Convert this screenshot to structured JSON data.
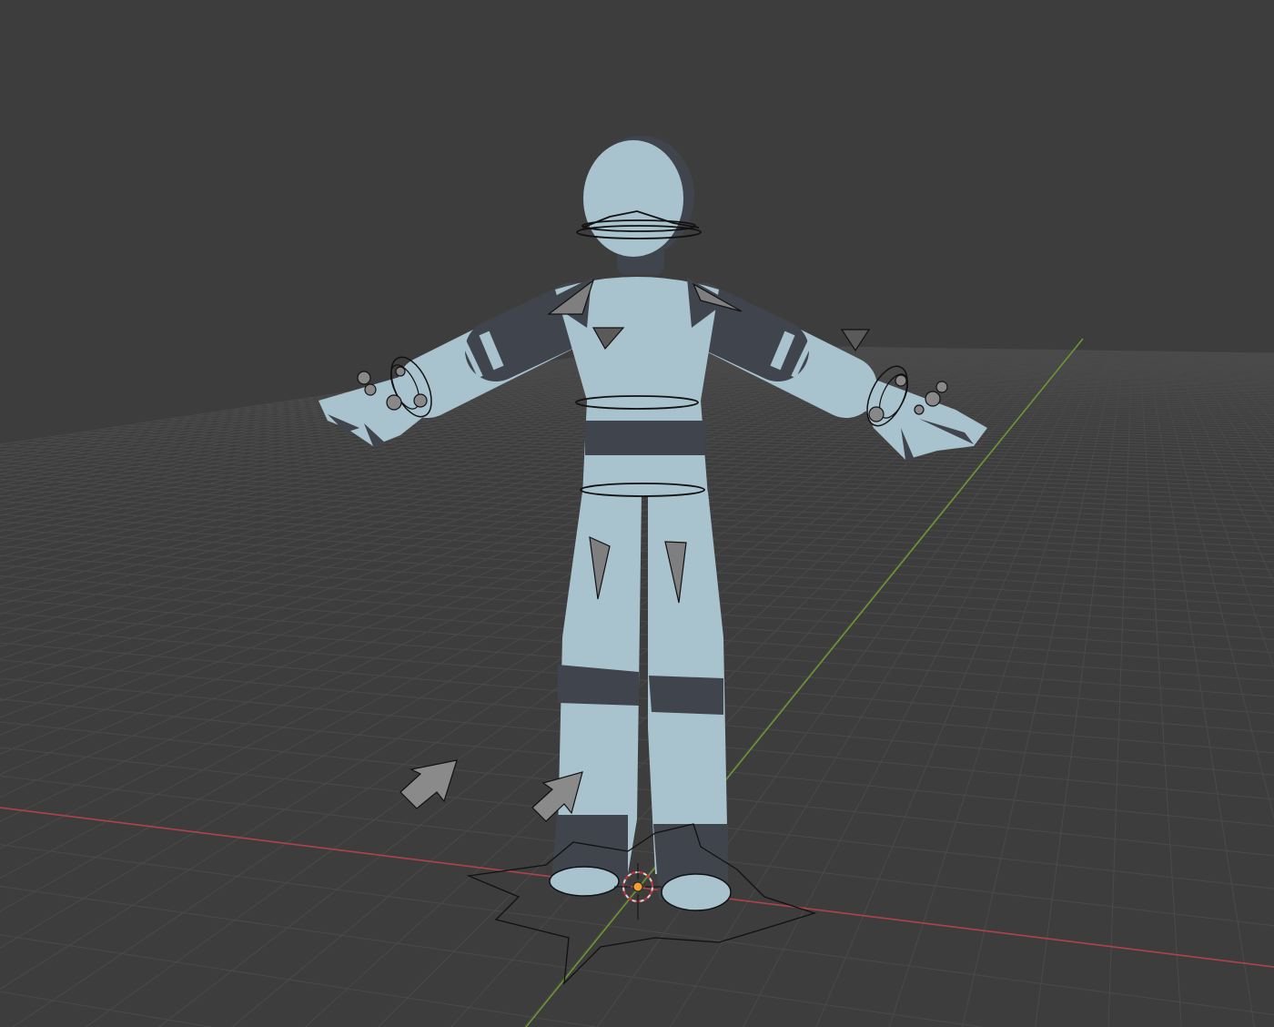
{
  "viewport": {
    "mode": "3D Viewport",
    "background_color": "#3d3d3d",
    "grid_color": "#4a4a4a",
    "x_axis_color": "#b5414b",
    "y_axis_color": "#6f9a2e"
  },
  "character": {
    "body_color": "#a8c2ce",
    "stripe_color": "#40444d",
    "rig_widget_color": "#7f7f7f"
  },
  "cursor_3d": {
    "icon": "3d-cursor-icon",
    "origin_color": "#f0a030"
  }
}
